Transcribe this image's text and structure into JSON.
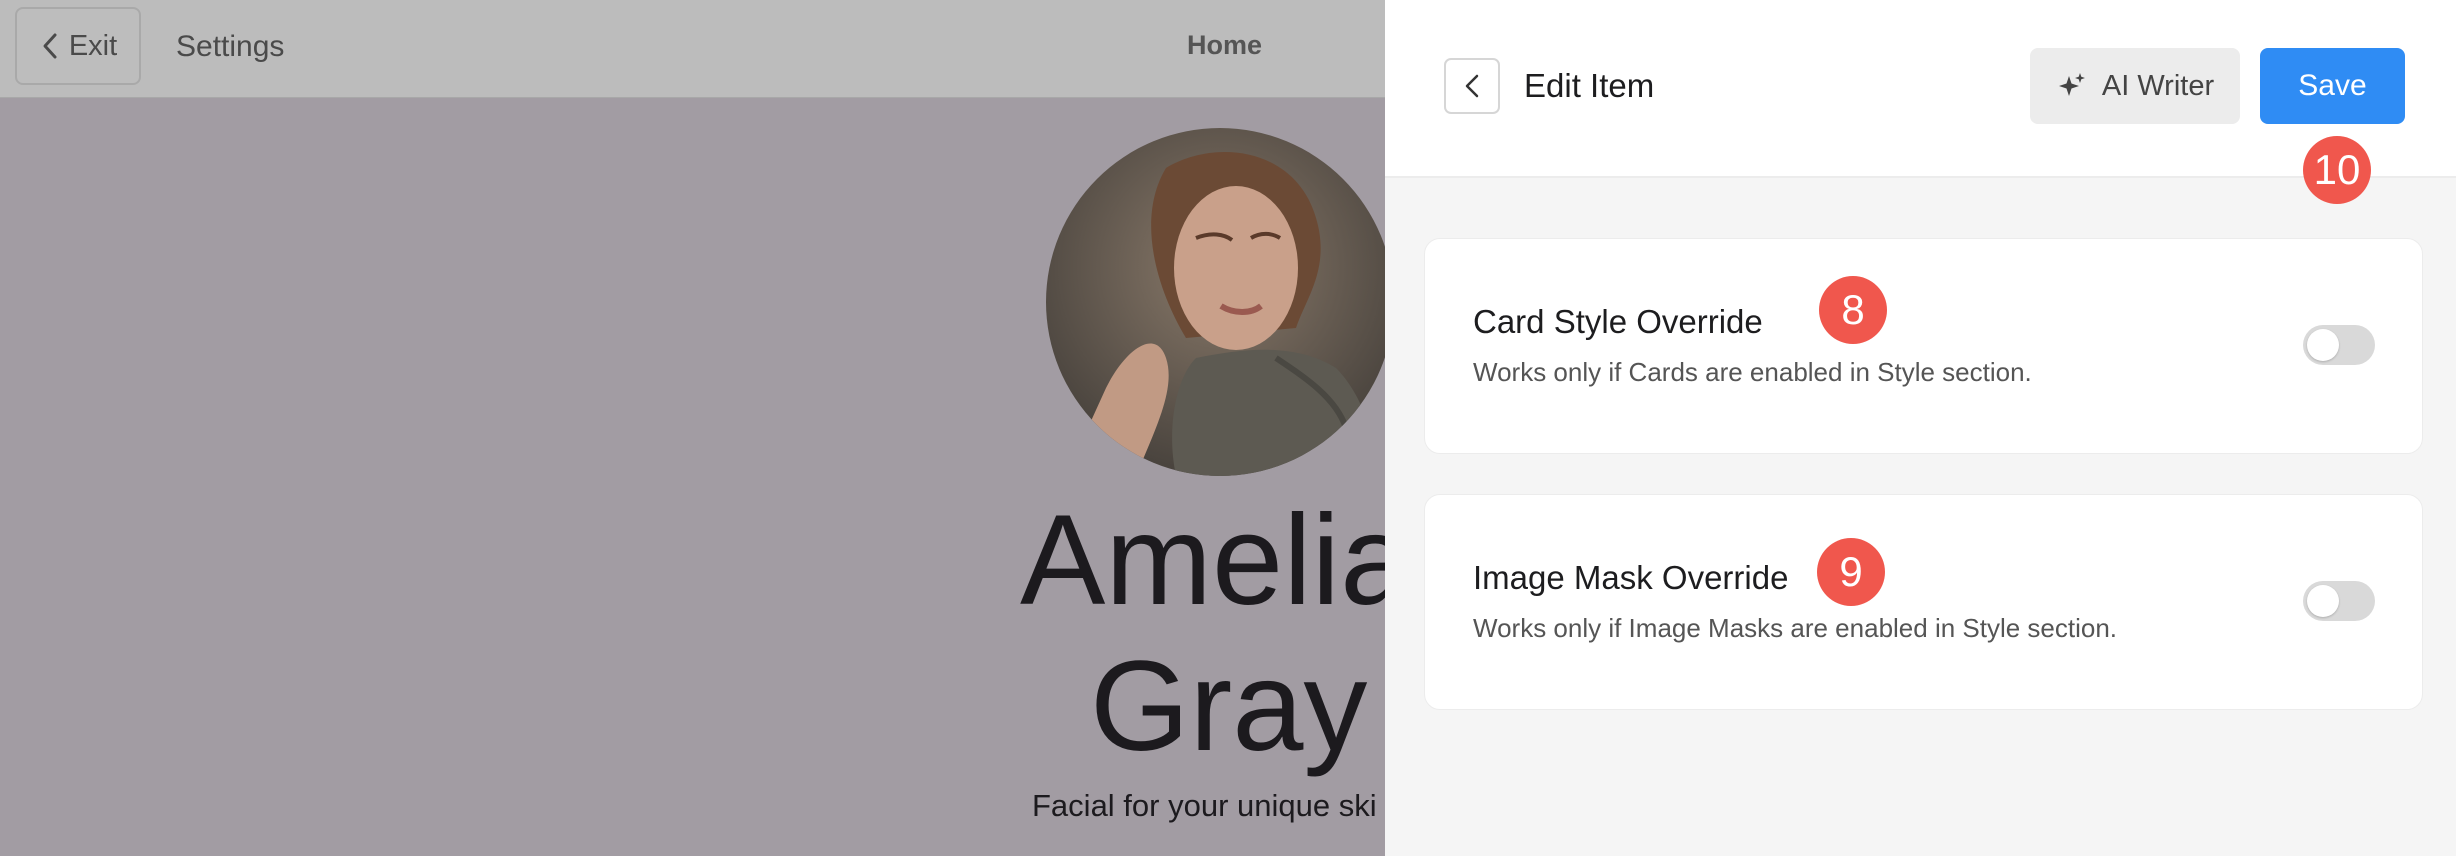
{
  "topbar": {
    "exit_label": "Exit",
    "settings_label": "Settings",
    "home_label": "Home"
  },
  "preview": {
    "name_line1": "Amelia",
    "name_line2": "Gray",
    "tagline": "Facial for your unique ski"
  },
  "panel": {
    "title": "Edit Item",
    "ai_writer_label": "AI Writer",
    "save_label": "Save",
    "colors": {
      "save": "#2f8cf4",
      "badge": "#f0574d"
    },
    "cards": [
      {
        "title": "Card Style Override",
        "description": "Works only if Cards are enabled in Style section.",
        "toggle_on": false
      },
      {
        "title": "Image Mask Override",
        "description": "Works only if Image Masks are enabled in Style section.",
        "toggle_on": false
      }
    ]
  },
  "badges": {
    "save": "10",
    "card_style": "8",
    "image_mask": "9"
  }
}
